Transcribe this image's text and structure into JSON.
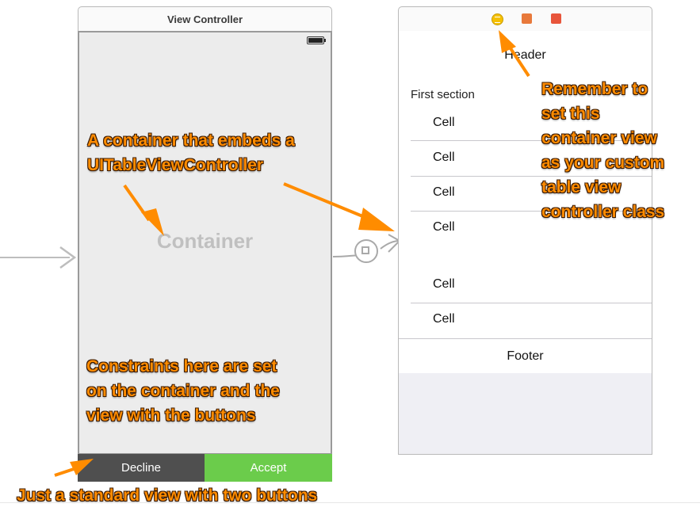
{
  "left_scene": {
    "title": "View Controller",
    "container_label": "Container",
    "buttons": {
      "decline": "Decline",
      "accept": "Accept"
    }
  },
  "right_scene": {
    "toolbar_icons": [
      "view-controller-icon",
      "first-responder-icon",
      "exit-icon"
    ],
    "header": "Header",
    "section_title": "First section",
    "cells": [
      "Cell",
      "Cell",
      "Cell",
      "Cell",
      "Cell",
      "Cell"
    ],
    "footer": "Footer"
  },
  "annotations": {
    "container_note": [
      "A container that embeds a",
      "UITableViewController"
    ],
    "class_note": [
      "Remember to",
      "set this",
      "container view",
      "as your custom",
      "table view",
      "controller class"
    ],
    "constraints_note": [
      "Constraints here are set",
      "on the container and the",
      "view with the buttons"
    ],
    "buttons_note": "Just a standard view with two buttons"
  },
  "colors": {
    "annotation": "#ff8c00",
    "accept_button": "#6bcc4b",
    "decline_button": "#4f4f4f"
  }
}
